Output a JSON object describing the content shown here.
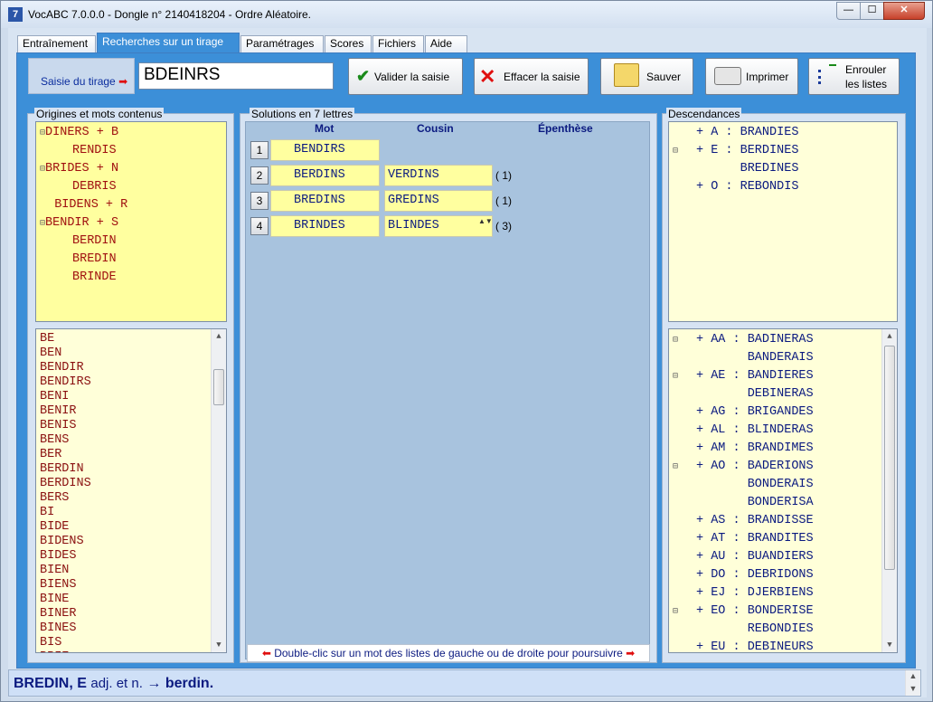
{
  "window": {
    "app_icon": "7",
    "title": "VocABC 7.0.0.0  - Dongle n° 2140418204  - Ordre Aléatoire.",
    "min": "—",
    "max": "☐",
    "close": "✕"
  },
  "tabs": [
    {
      "label": "Entraînement"
    },
    {
      "label": "Recherches sur un tirage"
    },
    {
      "label": "Paramétrages"
    },
    {
      "label": "Scores"
    },
    {
      "label": "Fichiers"
    },
    {
      "label": "Aide"
    }
  ],
  "saisie": {
    "label": "Saisie du tirage",
    "arrow": "➡",
    "value": "BDEINRS"
  },
  "toolbar": {
    "valider": "Valider la saisie",
    "effacer": "Effacer la saisie",
    "sauver": "Sauver",
    "imprimer": "Imprimer",
    "enrouler_1": "Enrouler",
    "enrouler_2": "les listes"
  },
  "origines": {
    "title": "Origines et mots contenus",
    "tree": [
      {
        "text": "DINERS + B",
        "level": 0,
        "expander": "⊟"
      },
      {
        "text": "RENDIS",
        "level": 1,
        "expander": ""
      },
      {
        "text": "BRIDES + N",
        "level": 0,
        "expander": "⊟"
      },
      {
        "text": "DEBRIS",
        "level": 1,
        "expander": ""
      },
      {
        "text": "BIDENS + R",
        "level": 0,
        "expander": ""
      },
      {
        "text": "BENDIR + S",
        "level": 0,
        "expander": "⊟"
      },
      {
        "text": "BERDIN",
        "level": 1,
        "expander": ""
      },
      {
        "text": "BREDIN",
        "level": 1,
        "expander": ""
      },
      {
        "text": "BRINDE",
        "level": 1,
        "expander": ""
      }
    ],
    "words": [
      "BE",
      "BEN",
      "BENDIR",
      "BENDIRS",
      "BENI",
      "BENIR",
      "BENIS",
      "BENS",
      "BER",
      "BERDIN",
      "BERDINS",
      "BERS",
      "BI",
      "BIDE",
      "BIDENS",
      "BIDES",
      "BIEN",
      "BIENS",
      "BINE",
      "BINER",
      "BINES",
      "BIS",
      "BRIE"
    ]
  },
  "solutions": {
    "title": "Solutions en 7 lettres",
    "col_mot": "Mot",
    "col_cousin": "Cousin",
    "col_epenthese": "Épenthèse",
    "rows": [
      {
        "num": "1",
        "mot": "BENDIRS",
        "cousin": "",
        "count": ""
      },
      {
        "num": "2",
        "mot": "BERDINS",
        "cousin": "VERDINS",
        "count": "( 1)"
      },
      {
        "num": "3",
        "mot": "BREDINS",
        "cousin": "GREDINS",
        "count": "( 1)"
      },
      {
        "num": "4",
        "mot": "BRINDES",
        "cousin": "BLINDES",
        "count": "( 3)"
      }
    ],
    "hint": "Double-clic sur un mot des listes de gauche ou de droite pour poursuivre"
  },
  "descendances": {
    "title": "Descendances",
    "tree": [
      {
        "text": "+ A : BRANDIES",
        "expander": ""
      },
      {
        "text": "+ E : BERDINES",
        "expander": "⊟"
      },
      {
        "text": "      BREDINES",
        "expander": ""
      },
      {
        "text": "+ O : REBONDIS",
        "expander": ""
      }
    ],
    "tree2": [
      {
        "text": "+ AA : BADINERAS",
        "expander": "⊟"
      },
      {
        "text": "       BANDERAIS",
        "expander": ""
      },
      {
        "text": "+ AE : BANDIERES",
        "expander": "⊟"
      },
      {
        "text": "       DEBINERAS",
        "expander": ""
      },
      {
        "text": "+ AG : BRIGANDES",
        "expander": ""
      },
      {
        "text": "+ AL : BLINDERAS",
        "expander": ""
      },
      {
        "text": "+ AM : BRANDIMES",
        "expander": ""
      },
      {
        "text": "+ AO : BADERIONS",
        "expander": "⊟"
      },
      {
        "text": "       BONDERAIS",
        "expander": ""
      },
      {
        "text": "       BONDERISA",
        "expander": ""
      },
      {
        "text": "+ AS : BRANDISSE",
        "expander": ""
      },
      {
        "text": "+ AT : BRANDITES",
        "expander": ""
      },
      {
        "text": "+ AU : BUANDIERS",
        "expander": ""
      },
      {
        "text": "+ DO : DEBRIDONS",
        "expander": ""
      },
      {
        "text": "+ EJ : DJERBIENS",
        "expander": ""
      },
      {
        "text": "+ EO : BONDERISE",
        "expander": "⊟"
      },
      {
        "text": "       REBONDIES",
        "expander": ""
      },
      {
        "text": "+ EU : DEBINEURS",
        "expander": ""
      }
    ]
  },
  "status": {
    "word": "BREDIN, E",
    "grammar": "adj. et n.",
    "arrow": "→",
    "root": "berdin."
  }
}
